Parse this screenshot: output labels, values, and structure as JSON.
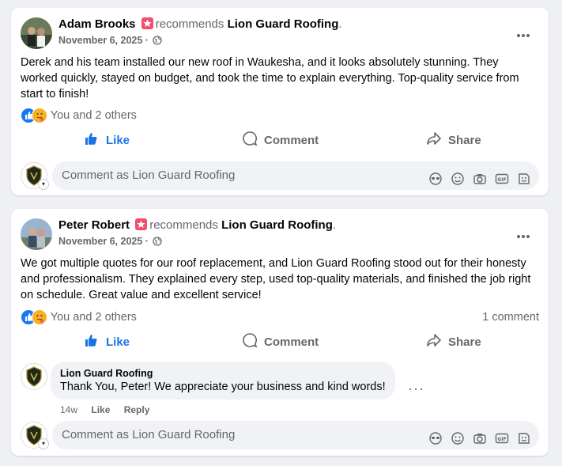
{
  "posts": [
    {
      "author": "Adam Brooks",
      "recommends": "recommends",
      "page": "Lion Guard Roofing",
      "date": "November 6, 2025",
      "text": "Derek and his team installed our new roof in Waukesha, and it looks absolutely stunning. They worked quickly, stayed on budget, and took the time to explain everything. Top-quality service from start to finish!",
      "reactions": "You and 2 others",
      "actions": {
        "like": "Like",
        "comment": "Comment",
        "share": "Share"
      },
      "compose_placeholder": "Comment as Lion Guard Roofing"
    },
    {
      "author": "Peter Robert",
      "recommends": "recommends",
      "page": "Lion Guard Roofing",
      "date": "November 6, 2025",
      "text": "We got multiple quotes for our roof replacement, and Lion Guard Roofing stood out for their honesty and professionalism. They explained every step, used top-quality materials, and finished the job right on schedule. Great value and excellent service!",
      "reactions": "You and 2 others",
      "comment_count": "1 comment",
      "actions": {
        "like": "Like",
        "comment": "Comment",
        "share": "Share"
      },
      "reply": {
        "author": "Lion Guard Roofing",
        "text": "Thank You, Peter! We appreciate your business and kind words!",
        "time": "14w",
        "like": "Like",
        "reply": "Reply"
      },
      "compose_placeholder": "Comment as Lion Guard Roofing"
    }
  ],
  "colors": {
    "accent": "#1b74e4",
    "recommend": "#f0506e",
    "muted": "#65676b"
  }
}
